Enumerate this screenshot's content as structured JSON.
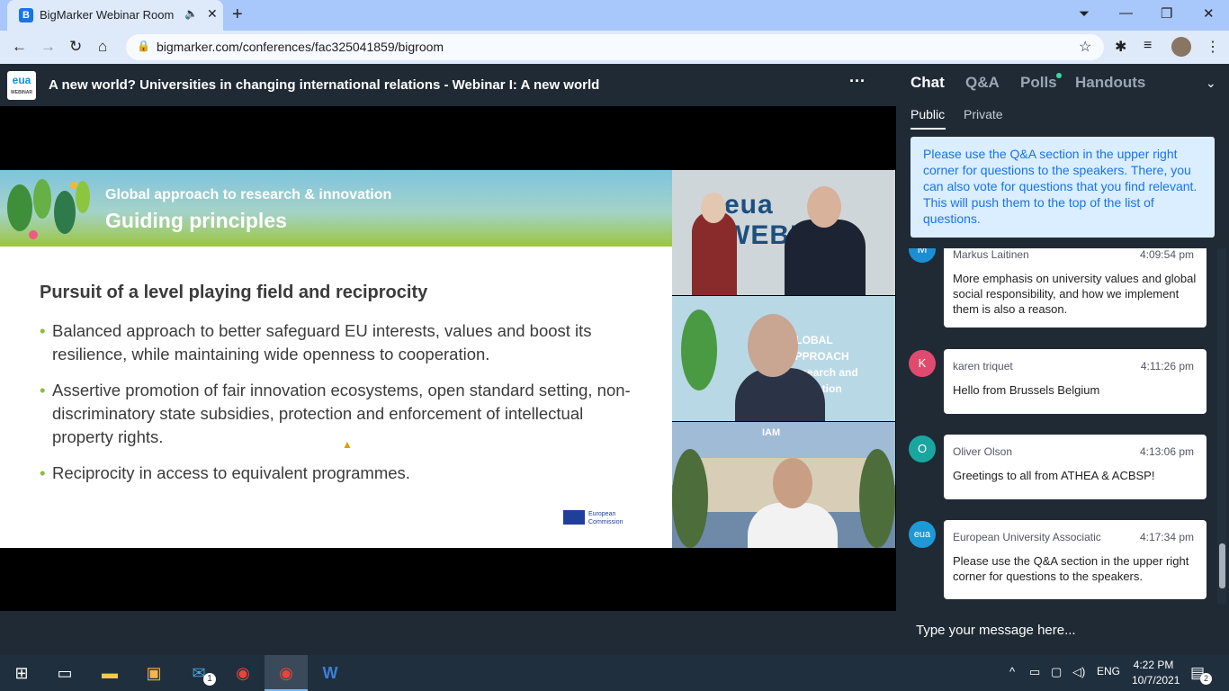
{
  "browser": {
    "tab_title": "BigMarker Webinar Room",
    "tab_favicon": "B",
    "url": "bigmarker.com/conferences/fac325041859/bigroom"
  },
  "header": {
    "logo_text": "eua",
    "logo_sub": "WEBINAR",
    "title": "A new world? Universities in changing international relations - Webinar I: A new world",
    "more": "···"
  },
  "slide": {
    "subtitle": "Global approach to research & innovation",
    "title": "Guiding principles",
    "heading": "Pursuit of a level playing field and reciprocity",
    "bullets": [
      "Balanced approach to better safeguard EU interests, values and boost its resilience, while maintaining wide openness to cooperation.",
      "Assertive promotion of fair innovation ecosystems, open standard setting, non-discriminatory state subsidies, protection and enforcement of intellectual property rights.",
      "Reciprocity in access to equivalent programmes."
    ],
    "footer_logo": "European Commission"
  },
  "cams": {
    "cam1_text": "eua WEBINA",
    "cam2_text": "GLOBAL APPROACH Research and Innovation",
    "cam3_text": "IAM"
  },
  "chat": {
    "tabs": [
      "Chat",
      "Q&A",
      "Polls",
      "Handouts"
    ],
    "subtabs": [
      "Public",
      "Private"
    ],
    "notice": "Please use the Q&A section in the upper right corner for questions to the speakers. There, you can also vote for questions that you find relevant. This will push them to the top of the list of questions.",
    "messages": [
      {
        "name": "Markus Laitinen",
        "time": "4:09:54 pm",
        "avatar": "M",
        "body": "More emphasis on university values and global social responsibility, and how we implement them is also a reason."
      },
      {
        "name": "karen triquet",
        "time": "4:11:26 pm",
        "avatar": "K",
        "body": "Hello from Brussels Belgium"
      },
      {
        "name": "Oliver Olson",
        "time": "4:13:06 pm",
        "avatar": "O",
        "body": "Greetings to all from ATHEA & ACBSP!"
      },
      {
        "name": "European University Associatic",
        "time": "4:17:34 pm",
        "avatar": "eua",
        "body": "Please use the Q&A section in the upper right corner for questions to the speakers."
      }
    ],
    "input_placeholder": "Type your message here..."
  },
  "taskbar": {
    "lang": "ENG",
    "time": "4:22 PM",
    "date": "10/7/2021",
    "mail_badge": "1",
    "notif_count": "2"
  }
}
